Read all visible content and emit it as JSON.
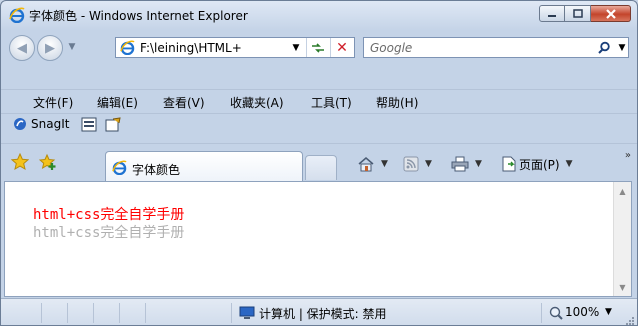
{
  "window": {
    "title": "字体颜色 - Windows Internet Explorer",
    "colors": {
      "close_button": "#c4452c",
      "frame": "#c4d3e7"
    }
  },
  "nav": {
    "back_icon": "back-arrow-icon",
    "forward_icon": "forward-arrow-icon"
  },
  "address_bar": {
    "value": "F:\\leining\\HTML+",
    "refresh_icon": "refresh-icon",
    "stop_icon": "stop-icon"
  },
  "search": {
    "placeholder": "Google",
    "button_icon": "search-icon"
  },
  "menu": {
    "items": [
      "文件(F)",
      "编辑(E)",
      "查看(V)",
      "收藏夹(A)",
      "工具(T)",
      "帮助(H)"
    ]
  },
  "snagit": {
    "label": "SnagIt"
  },
  "tabs": {
    "active_label": "字体颜色"
  },
  "command_bar": {
    "page_label": "页面(P)"
  },
  "content": {
    "line1": "html+css完全自学手册",
    "line2": "html+css完全自学手册",
    "colors": {
      "line1": "#ff0000",
      "line2": "#b0b0b0"
    }
  },
  "status": {
    "zone": "计算机 | 保护模式: 禁用",
    "zoom": "100%"
  }
}
